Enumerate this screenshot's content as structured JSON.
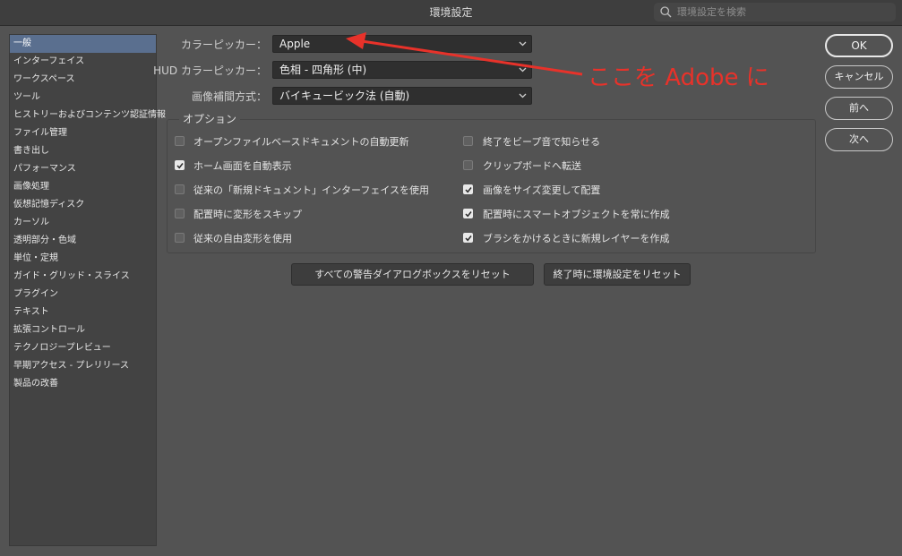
{
  "window": {
    "title": "環境設定"
  },
  "search": {
    "placeholder": "環境設定を検索"
  },
  "sidebar": {
    "items": [
      {
        "label": "一般",
        "active": true
      },
      {
        "label": "インターフェイス"
      },
      {
        "label": "ワークスペース"
      },
      {
        "label": "ツール"
      },
      {
        "label": "ヒストリーおよびコンテンツ認証情報"
      },
      {
        "label": "ファイル管理"
      },
      {
        "label": "書き出し"
      },
      {
        "label": "パフォーマンス"
      },
      {
        "label": "画像処理"
      },
      {
        "label": "仮想記憶ディスク"
      },
      {
        "label": "カーソル"
      },
      {
        "label": "透明部分・色域"
      },
      {
        "label": "単位・定規"
      },
      {
        "label": "ガイド・グリッド・スライス"
      },
      {
        "label": "プラグイン"
      },
      {
        "label": "テキスト"
      },
      {
        "label": "拡張コントロール"
      },
      {
        "label": "テクノロジープレビュー"
      },
      {
        "label": "早期アクセス - プレリリース"
      },
      {
        "label": "製品の改善"
      }
    ]
  },
  "settings": {
    "color_picker": {
      "label": "カラーピッカー：",
      "value": "Apple"
    },
    "hud_color_picker": {
      "label": "HUD カラーピッカー：",
      "value": "色相 - 四角形 (中)"
    },
    "interpolation": {
      "label": "画像補間方式：",
      "value": "バイキュービック法 (自動)"
    }
  },
  "options": {
    "title": "オプション",
    "left": [
      {
        "label": "オープンファイルベースドキュメントの自動更新",
        "checked": false
      },
      {
        "label": "ホーム画面を自動表示",
        "checked": true
      },
      {
        "label": "従来の「新規ドキュメント」インターフェイスを使用",
        "checked": false
      },
      {
        "label": "配置時に変形をスキップ",
        "checked": false
      },
      {
        "label": "従来の自由変形を使用",
        "checked": false
      }
    ],
    "right": [
      {
        "label": "終了をビープ音で知らせる",
        "checked": false
      },
      {
        "label": "クリップボードへ転送",
        "checked": false
      },
      {
        "label": "画像をサイズ変更して配置",
        "checked": true
      },
      {
        "label": "配置時にスマートオブジェクトを常に作成",
        "checked": true
      },
      {
        "label": "ブラシをかけるときに新規レイヤーを作成",
        "checked": true
      }
    ]
  },
  "reset_buttons": {
    "reset_warnings": "すべての警告ダイアログボックスをリセット",
    "reset_on_quit": "終了時に環境設定をリセット"
  },
  "dialog_buttons": {
    "ok": "OK",
    "cancel": "キャンセル",
    "prev": "前へ",
    "next": "次へ"
  },
  "annotation": {
    "text": "ここを Adobe に",
    "color": "#e8322a"
  },
  "colors": {
    "background": "#535353",
    "titlebar": "#3e3e3e",
    "sidebar_selected": "#5a6f8f"
  }
}
